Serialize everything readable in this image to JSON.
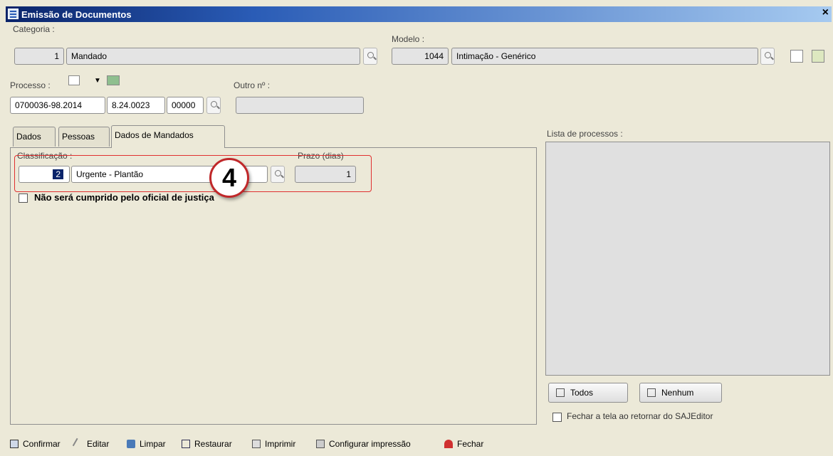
{
  "window": {
    "title": "Emissão de Documentos",
    "close": "×"
  },
  "categoria": {
    "label": "Categoria :",
    "code": "1",
    "name": "Mandado"
  },
  "modelo": {
    "label": "Modelo :",
    "code": "1044",
    "name": "Intimação - Genérico"
  },
  "processo": {
    "label": "Processo :",
    "part1": "0700036-98.2014",
    "part2": "8.24.0023",
    "part3": "00000",
    "outro_label": "Outro nº :"
  },
  "tabs": [
    {
      "label": "Dados"
    },
    {
      "label": "Pessoas"
    },
    {
      "label": "Dados de Mandados"
    }
  ],
  "mandado": {
    "classificacao_label": "Classificação :",
    "classificacao_code": "2",
    "classificacao_name": "Urgente - Plantão",
    "prazo_label": "Prazo (dias)",
    "prazo_value": "1",
    "checkbox_label": "Não será cumprido pelo oficial de justiça"
  },
  "lista": {
    "label": "Lista de processos :",
    "todos": "Todos",
    "nenhum": "Nenhum",
    "fechar_label": "Fechar a tela ao retornar do SAJEditor"
  },
  "annotation": {
    "step": "4",
    "color": "#e03030"
  },
  "toolbar": {
    "confirmar": "Confirmar",
    "editar": "Editar",
    "limpar": "Limpar",
    "restaurar": "Restaurar",
    "imprimir": "Imprimir",
    "configurar": "Configurar impressão",
    "fechar": "Fechar"
  }
}
